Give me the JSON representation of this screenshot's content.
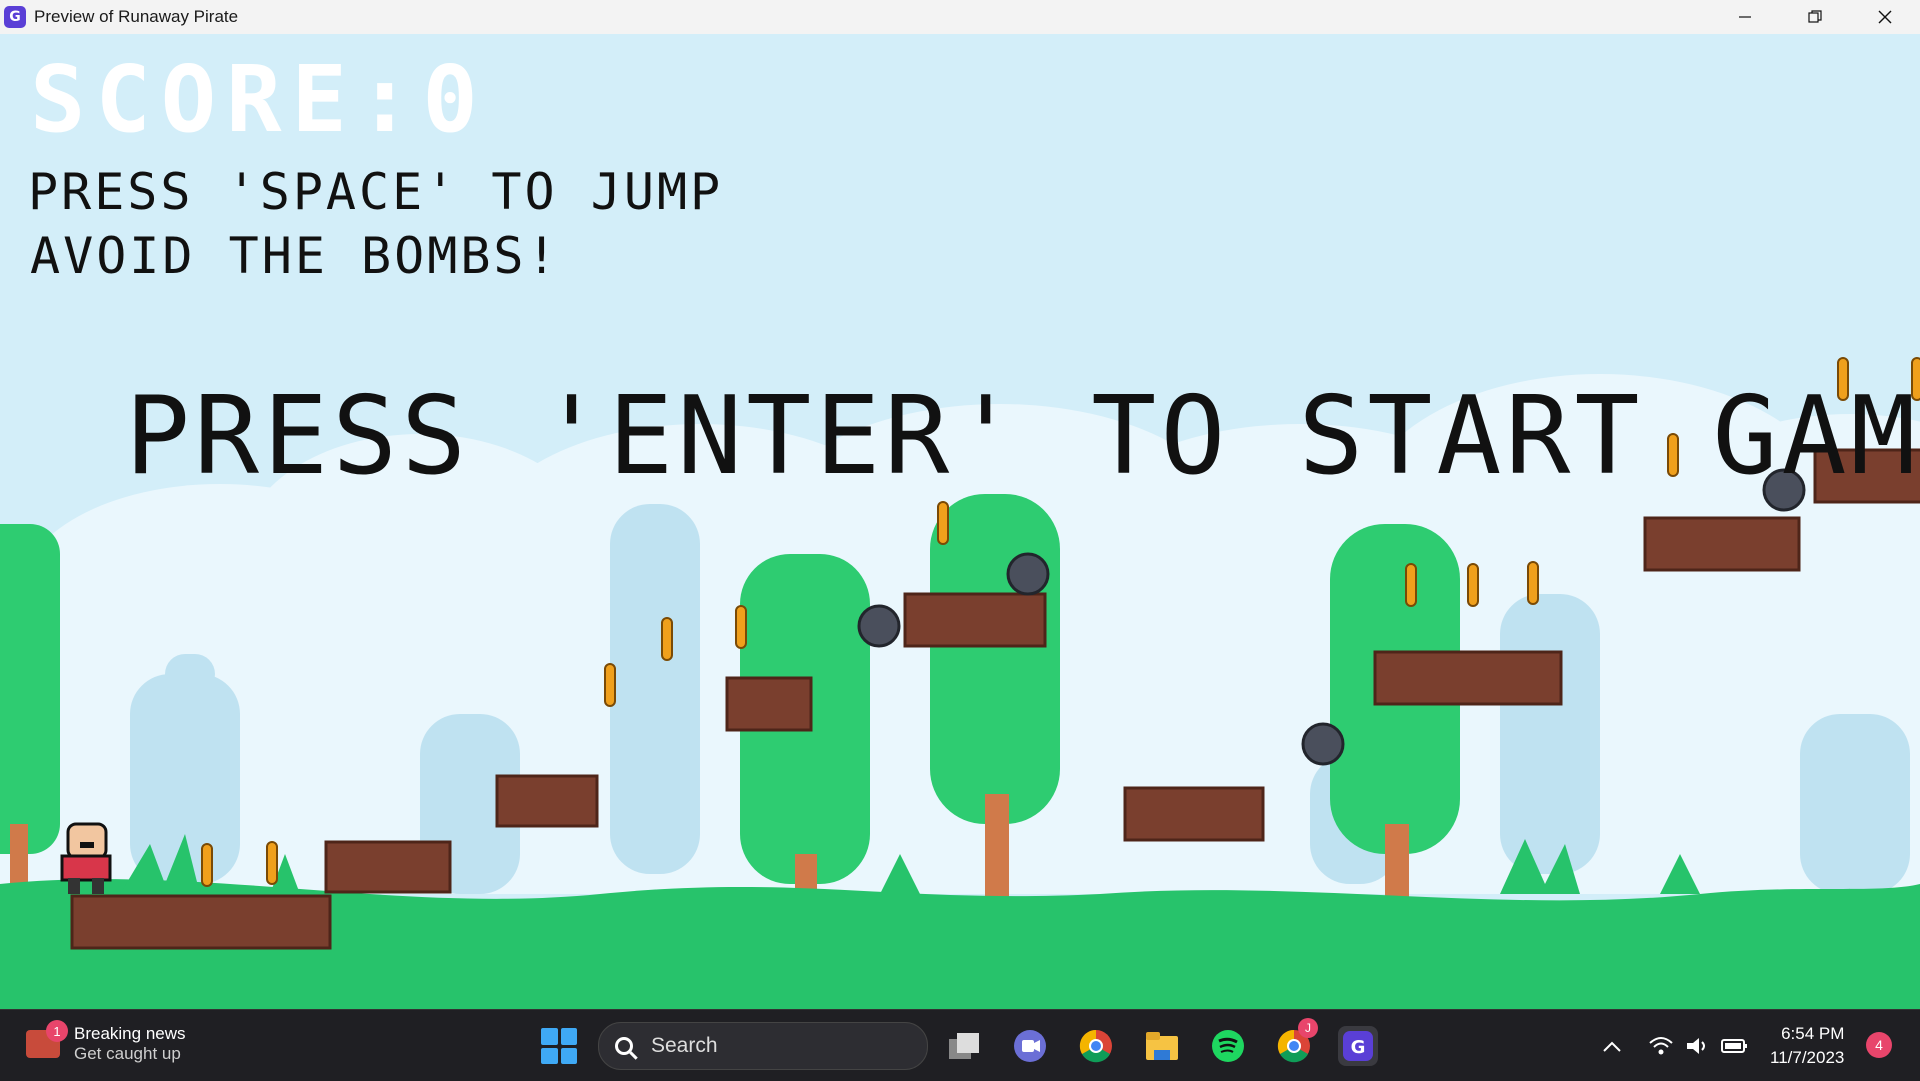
{
  "window": {
    "title": "Preview of Runaway Pirate",
    "app_icon": "G",
    "minimize_icon": "minimize-icon",
    "maximize_icon": "restore-icon",
    "close_icon": "close-icon"
  },
  "game": {
    "score_text": "SCORE:0",
    "hint_jump": "PRESS 'SPACE' TO JUMP",
    "hint_avoid": "AVOID THE BOMBS!",
    "start_message": "PRESS 'ENTER' TO START GAME",
    "colors": {
      "sky": "#d3eef9",
      "grass": "#27c36b",
      "tree": "#2ecc71",
      "brick": "#7a3f2e",
      "coin": "#f0a01c",
      "bomb": "#4a4f5c"
    }
  },
  "taskbar": {
    "news_badge": "1",
    "news_title": "Breaking news",
    "news_subtitle": "Get caught up",
    "search_placeholder": "Search",
    "apps": [
      "start-icon",
      "task-view-icon",
      "teams-icon",
      "chrome-icon",
      "file-explorer-icon",
      "spotify-icon",
      "chrome-profile-icon",
      "gdevelop-icon"
    ],
    "chrome_profile_badge": "J",
    "time": "6:54 PM",
    "date": "11/7/2023",
    "notification_count": "4"
  }
}
